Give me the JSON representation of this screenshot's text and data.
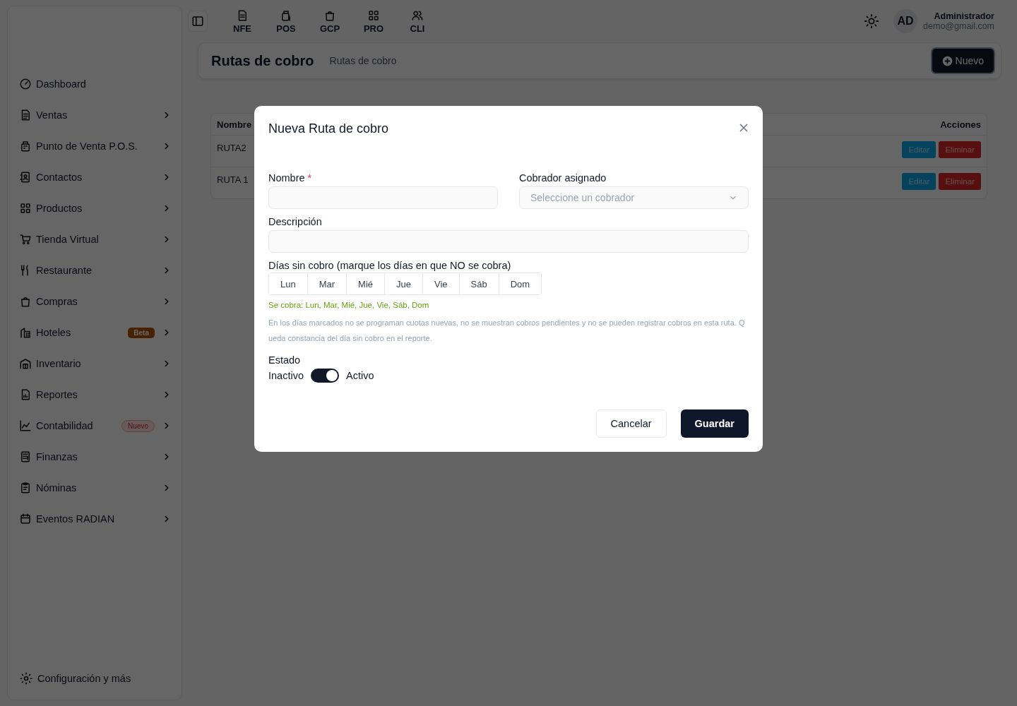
{
  "topbar": {
    "shortcuts": [
      {
        "label": "NFE"
      },
      {
        "label": "POS"
      },
      {
        "label": "GCP"
      },
      {
        "label": "PRO"
      },
      {
        "label": "CLI"
      }
    ],
    "user": {
      "initials": "AD",
      "name": "Administrador",
      "email": "demo@gmail.com"
    }
  },
  "sidebar": {
    "items": [
      {
        "label": "Dashboard",
        "expandable": false
      },
      {
        "label": "Ventas",
        "expandable": true
      },
      {
        "label": "Punto de Venta P.O.S.",
        "expandable": true
      },
      {
        "label": "Contactos",
        "expandable": true
      },
      {
        "label": "Productos",
        "expandable": true
      },
      {
        "label": "Tienda Virtual",
        "expandable": true
      },
      {
        "label": "Restaurante",
        "expandable": true
      },
      {
        "label": "Compras",
        "expandable": true
      },
      {
        "label": "Hoteles",
        "expandable": true,
        "badge": {
          "text": "Beta",
          "kind": "beta"
        }
      },
      {
        "label": "Inventario",
        "expandable": true
      },
      {
        "label": "Reportes",
        "expandable": true
      },
      {
        "label": "Contabilidad",
        "expandable": true,
        "badge": {
          "text": "Nuevo",
          "kind": "new"
        }
      },
      {
        "label": "Finanzas",
        "expandable": true
      },
      {
        "label": "Nóminas",
        "expandable": true
      },
      {
        "label": "Eventos RADIAN",
        "expandable": true
      }
    ],
    "footer": "Configuración y más"
  },
  "page_header": {
    "title": "Rutas de cobro",
    "breadcrumb": "Rutas de cobro",
    "new_button": "Nuevo"
  },
  "table": {
    "columns": [
      "Nombre",
      "Acciones"
    ],
    "rows": [
      {
        "name": "RUTA2",
        "edit": "Editar",
        "delete": "Eliminar"
      },
      {
        "name": "RUTA 1",
        "edit": "Editar",
        "delete": "Eliminar"
      }
    ]
  },
  "modal": {
    "title": "Nueva Ruta de cobro",
    "name_label": "Nombre",
    "required_mark": "*",
    "collector_label": "Cobrador asignado",
    "collector_placeholder": "Seleccione un cobrador",
    "description_label": "Descripción",
    "days_label": "Días sin cobro (marque los días en que NO se cobra)",
    "days": [
      {
        "label": "Lun",
        "selected": false
      },
      {
        "label": "Mar",
        "selected": false
      },
      {
        "label": "Mié",
        "selected": false
      },
      {
        "label": "Jue",
        "selected": false
      },
      {
        "label": "Vie",
        "selected": false
      },
      {
        "label": "Sáb",
        "selected": false
      },
      {
        "label": "Dom",
        "selected": false
      }
    ],
    "charge_summary": "Se cobra: Lun, Mar, Mié, Jue, Vie, Sáb, Dom",
    "help": "En los días marcados no se programan cuotas nuevas, no se muestran cobros pendientes y no se pueden registrar cobros en esta ruta. Queda constancia del día sin cobro en el reporte.",
    "status_label": "Estado",
    "off_label": "Inactivo",
    "on_label": "Activo",
    "on": true,
    "cancel": "Cancelar",
    "save": "Guardar"
  }
}
